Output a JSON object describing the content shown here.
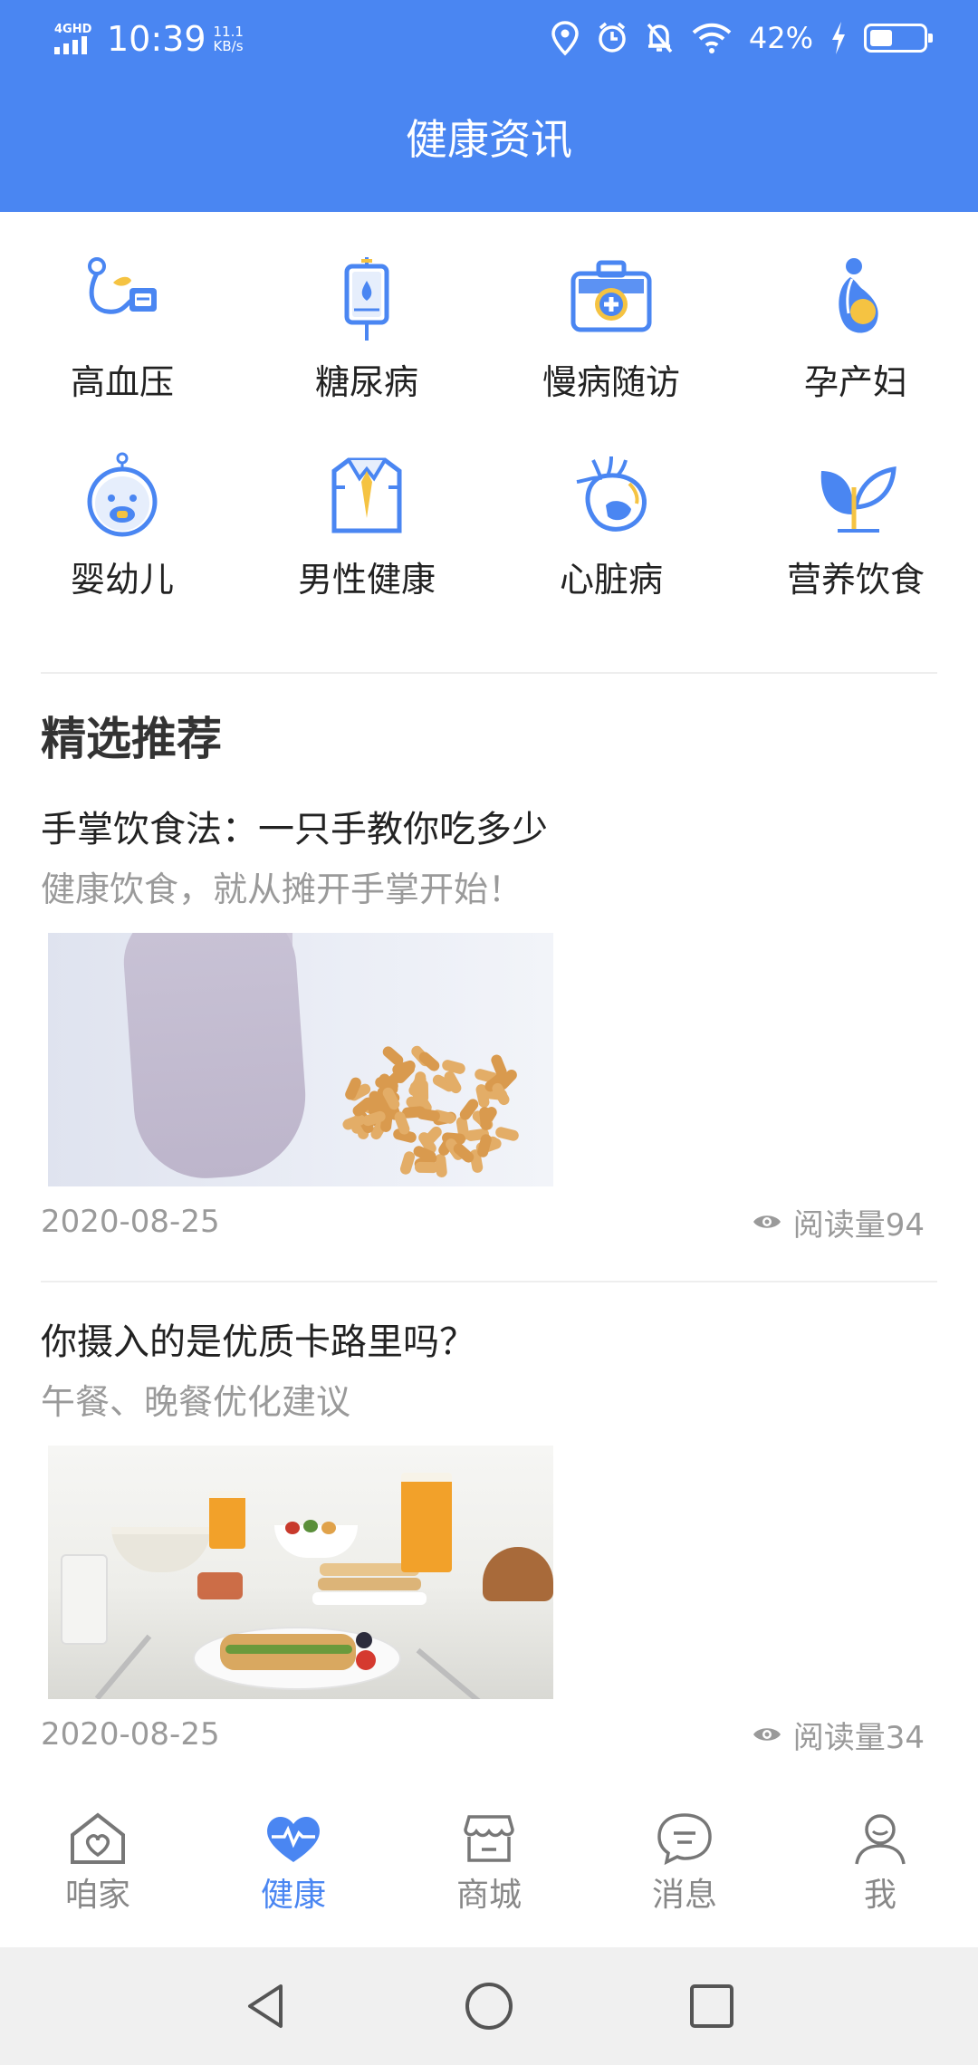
{
  "status_bar": {
    "network": "4GHD",
    "time": "10:39",
    "speed_value": "11.1",
    "speed_unit": "KB/s",
    "battery": "42%",
    "battery_level": 0.42
  },
  "header": {
    "title": "健康资讯"
  },
  "categories": [
    {
      "label": "高血压",
      "icon": "stethoscope-icon"
    },
    {
      "label": "糖尿病",
      "icon": "iv-drip-icon"
    },
    {
      "label": "慢病随访",
      "icon": "medical-kit-icon"
    },
    {
      "label": "孕产妇",
      "icon": "pregnant-icon"
    },
    {
      "label": "婴幼儿",
      "icon": "baby-icon"
    },
    {
      "label": "男性健康",
      "icon": "shirt-tie-icon"
    },
    {
      "label": "心脏病",
      "icon": "heart-organ-icon"
    },
    {
      "label": "营养饮食",
      "icon": "sprout-icon"
    }
  ],
  "section": {
    "title": "精选推荐"
  },
  "articles": [
    {
      "title": "手掌饮食法：一只手教你吃多少",
      "subtitle": "健康饮食，就从摊开手掌开始！",
      "date": "2020-08-25",
      "views": "阅读量94"
    },
    {
      "title": "你摄入的是优质卡路里吗？",
      "subtitle": "午餐、晚餐优化建议",
      "date": "2020-08-25",
      "views": "阅读量34"
    }
  ],
  "bottom_nav": [
    {
      "label": "咱家",
      "icon": "home-icon",
      "active": false
    },
    {
      "label": "健康",
      "icon": "heartbeat-icon",
      "active": true
    },
    {
      "label": "商城",
      "icon": "shop-icon",
      "active": false
    },
    {
      "label": "消息",
      "icon": "message-icon",
      "active": false
    },
    {
      "label": "我",
      "icon": "profile-icon",
      "active": false
    }
  ],
  "colors": {
    "primary": "#4a86f2",
    "accent_yellow": "#f5c342",
    "muted_text": "#9a9a9a"
  }
}
